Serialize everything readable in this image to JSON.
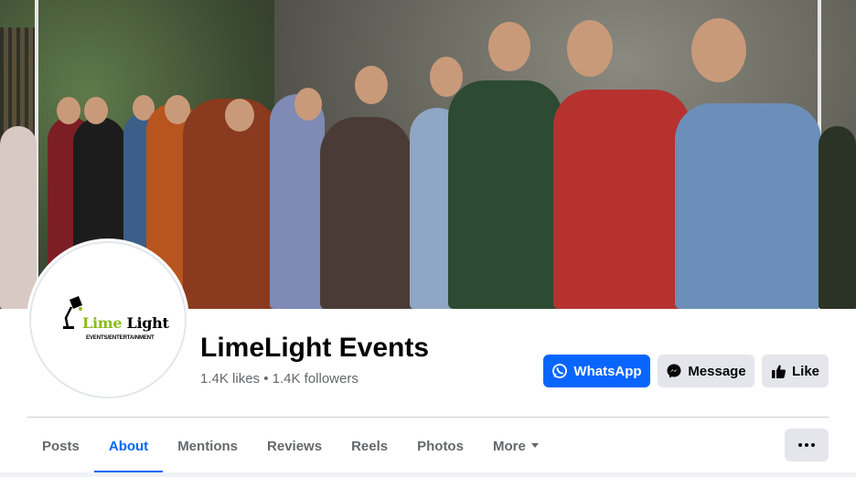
{
  "page": {
    "name": "LimeLight Events",
    "stats": "1.4K likes • 1.4K followers"
  },
  "logo": {
    "word1": "Lime",
    "word2": "Light",
    "tagline": "EVENTS/ENTERTAINMENT"
  },
  "actions": {
    "whatsapp_label": "WhatsApp",
    "message_label": "Message",
    "like_label": "Like"
  },
  "tabs": [
    {
      "label": "Posts",
      "active": false
    },
    {
      "label": "About",
      "active": true
    },
    {
      "label": "Mentions",
      "active": false
    },
    {
      "label": "Reviews",
      "active": false
    },
    {
      "label": "Reels",
      "active": false
    },
    {
      "label": "Photos",
      "active": false
    },
    {
      "label": "More",
      "active": false
    }
  ],
  "icons": {
    "whatsapp": "whatsapp-icon",
    "messenger": "messenger-icon",
    "like": "thumbs-up-icon",
    "more": "ellipsis-icon",
    "caret": "caret-down-icon"
  },
  "colors": {
    "primary": "#0866ff",
    "secondary_button": "#e4e6eb",
    "text_primary": "#050505",
    "text_secondary": "#65676b",
    "logo_lime": "#8dbb1c"
  }
}
